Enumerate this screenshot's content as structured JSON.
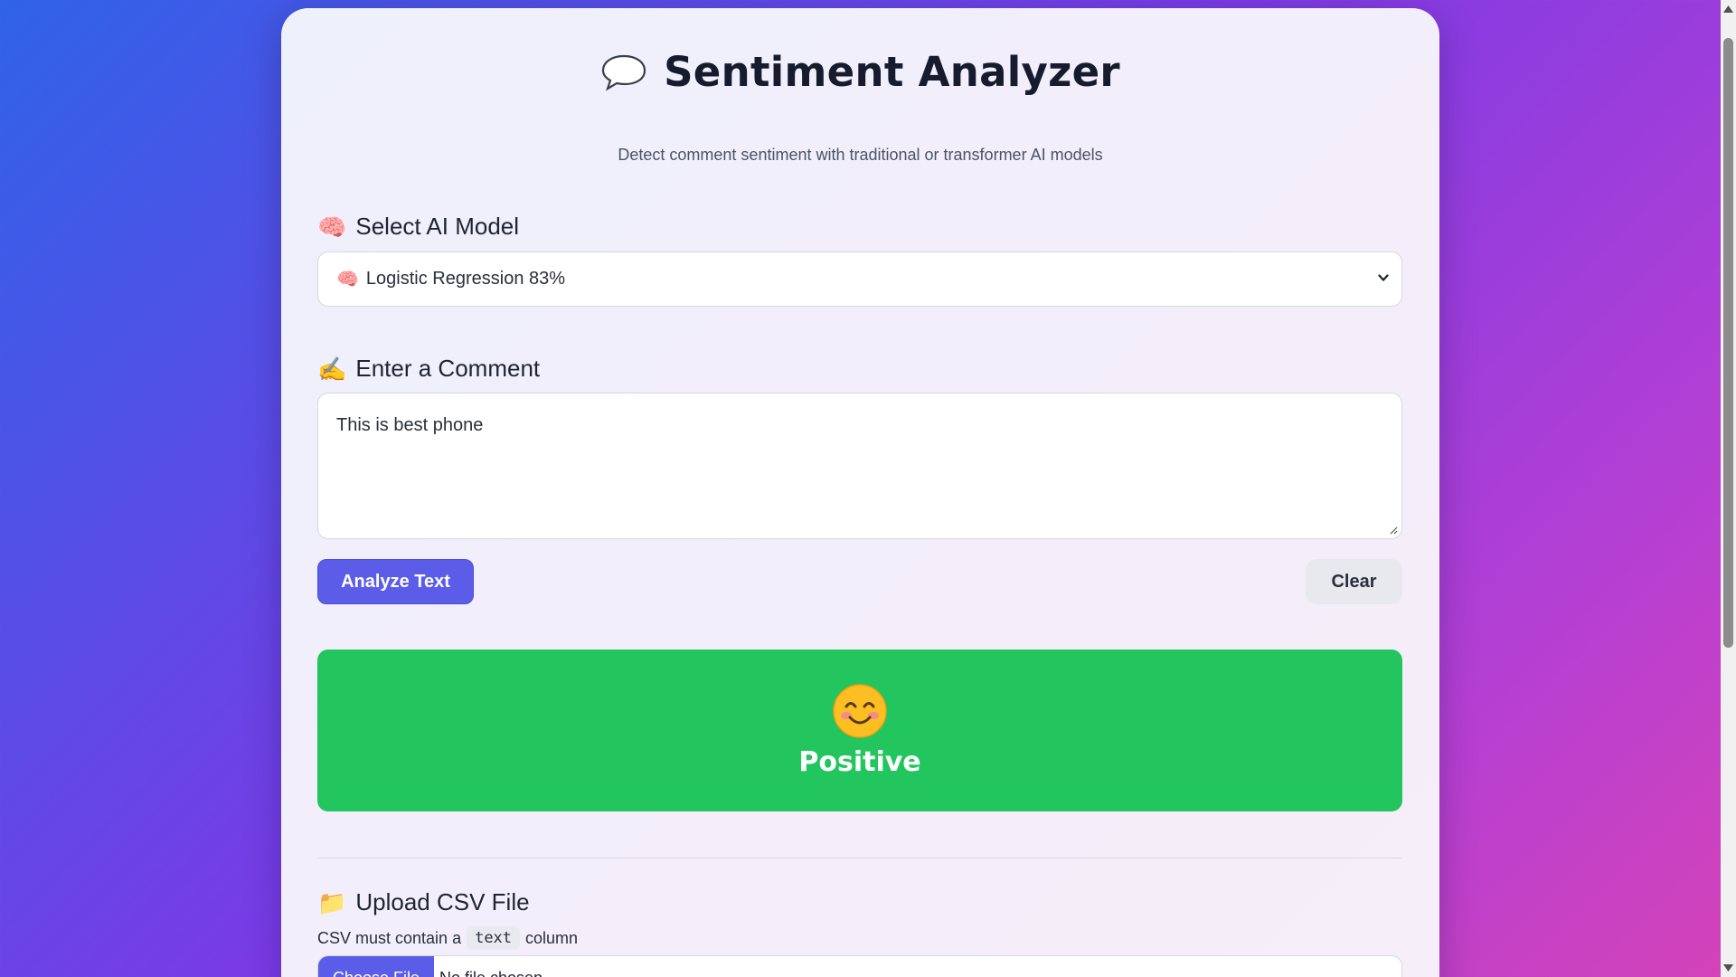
{
  "header": {
    "title": "Sentiment Analyzer",
    "subtitle": "Detect comment sentiment with traditional or transformer AI models",
    "icon": "speech-bubble-icon"
  },
  "model_section": {
    "icon": "🧠",
    "label": "Select AI Model",
    "selected_icon": "🧠",
    "selected": "Logistic Regression 83%"
  },
  "comment_section": {
    "icon": "✍️",
    "label": "Enter a Comment",
    "value": "This is best phone"
  },
  "actions": {
    "analyze_label": "Analyze Text",
    "clear_label": "Clear"
  },
  "result": {
    "label": "Positive",
    "icon": "smiling-face-icon",
    "color": "#22c55e"
  },
  "upload_section": {
    "icon": "📁",
    "label": "Upload CSV File",
    "hint_before": "CSV must contain a",
    "hint_code": "text",
    "hint_after": "column",
    "choose_label": "Choose File",
    "status": "No file chosen"
  },
  "colors": {
    "accent": "#5b5de8",
    "positive": "#22c55e"
  }
}
